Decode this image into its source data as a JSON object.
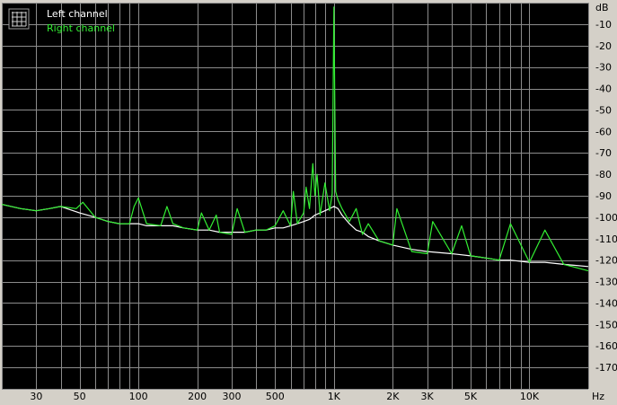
{
  "chart_data": {
    "type": "line",
    "title": "",
    "xlabel": "Hz",
    "ylabel": "dB",
    "x_scale": "log",
    "xlim": [
      20,
      20000
    ],
    "ylim": [
      -180,
      0
    ],
    "grid": true,
    "legend_position": "top-left",
    "x_tick_labels": [
      {
        "value": 30,
        "label": "30"
      },
      {
        "value": 50,
        "label": "50"
      },
      {
        "value": 100,
        "label": "100"
      },
      {
        "value": 200,
        "label": "200"
      },
      {
        "value": 300,
        "label": "300"
      },
      {
        "value": 500,
        "label": "500"
      },
      {
        "value": 1000,
        "label": "1K"
      },
      {
        "value": 2000,
        "label": "2K"
      },
      {
        "value": 3000,
        "label": "3K"
      },
      {
        "value": 5000,
        "label": "5K"
      },
      {
        "value": 10000,
        "label": "10K"
      }
    ],
    "y_tick_labels": [
      {
        "value": -10,
        "label": "-10"
      },
      {
        "value": -20,
        "label": "-20"
      },
      {
        "value": -30,
        "label": "-30"
      },
      {
        "value": -40,
        "label": "-40"
      },
      {
        "value": -50,
        "label": "-50"
      },
      {
        "value": -60,
        "label": "-60"
      },
      {
        "value": -70,
        "label": "-70"
      },
      {
        "value": -80,
        "label": "-80"
      },
      {
        "value": -90,
        "label": "-90"
      },
      {
        "value": -100,
        "label": "-100"
      },
      {
        "value": -110,
        "label": "-110"
      },
      {
        "value": -120,
        "label": "-120"
      },
      {
        "value": -130,
        "label": "-130"
      },
      {
        "value": -140,
        "label": "-140"
      },
      {
        "value": -150,
        "label": "-150"
      },
      {
        "value": -160,
        "label": "-160"
      },
      {
        "value": -170,
        "label": "-170"
      }
    ],
    "series": [
      {
        "name": "Left channel",
        "color": "#ffffff",
        "x": [
          20,
          25,
          30,
          35,
          40,
          50,
          60,
          70,
          80,
          90,
          100,
          110,
          130,
          150,
          170,
          200,
          230,
          260,
          300,
          350,
          400,
          450,
          500,
          550,
          600,
          650,
          700,
          750,
          800,
          850,
          900,
          950,
          1000,
          1050,
          1100,
          1200,
          1300,
          1400,
          1500,
          1700,
          2000,
          2500,
          3000,
          4000,
          5000,
          6000,
          7000,
          8000,
          10000,
          12000,
          15000,
          20000
        ],
        "values": [
          -94,
          -96,
          -97,
          -96,
          -95,
          -98,
          -100,
          -102,
          -103,
          -103,
          -103,
          -104,
          -104,
          -104,
          -105,
          -106,
          -106,
          -107,
          -107,
          -107,
          -106,
          -106,
          -105,
          -105,
          -104,
          -103,
          -102,
          -101,
          -99,
          -98,
          -97,
          -96,
          -95,
          -96,
          -99,
          -103,
          -106,
          -107,
          -109,
          -111,
          -113,
          -115,
          -116,
          -117,
          -118,
          -119,
          -120,
          -120,
          -121,
          -121,
          -122,
          -123
        ]
      },
      {
        "name": "Right channel",
        "color": "#33ee33",
        "x": [
          20,
          25,
          30,
          35,
          40,
          48,
          52,
          60,
          70,
          80,
          90,
          95,
          100,
          110,
          130,
          140,
          150,
          170,
          200,
          210,
          230,
          250,
          260,
          300,
          320,
          350,
          400,
          450,
          500,
          550,
          600,
          620,
          650,
          700,
          720,
          750,
          780,
          800,
          820,
          850,
          900,
          950,
          980,
          1000,
          1020,
          1050,
          1100,
          1200,
          1300,
          1400,
          1500,
          1700,
          2000,
          2100,
          2500,
          3000,
          3200,
          4000,
          4500,
          5000,
          6000,
          7000,
          8000,
          10000,
          12000,
          15000,
          20000
        ],
        "values": [
          -94,
          -96,
          -97,
          -96,
          -95,
          -96,
          -93,
          -100,
          -102,
          -103,
          -103,
          -95,
          -91,
          -103,
          -104,
          -95,
          -103,
          -105,
          -106,
          -98,
          -106,
          -99,
          -107,
          -108,
          -96,
          -107,
          -106,
          -106,
          -104,
          -97,
          -104,
          -88,
          -103,
          -98,
          -86,
          -96,
          -75,
          -90,
          -80,
          -99,
          -84,
          -97,
          -89,
          -2,
          -88,
          -92,
          -96,
          -102,
          -96,
          -108,
          -103,
          -111,
          -113,
          -96,
          -116,
          -117,
          -102,
          -117,
          -104,
          -118,
          -119,
          -120,
          -103,
          -121,
          -106,
          -122,
          -125
        ]
      }
    ]
  }
}
